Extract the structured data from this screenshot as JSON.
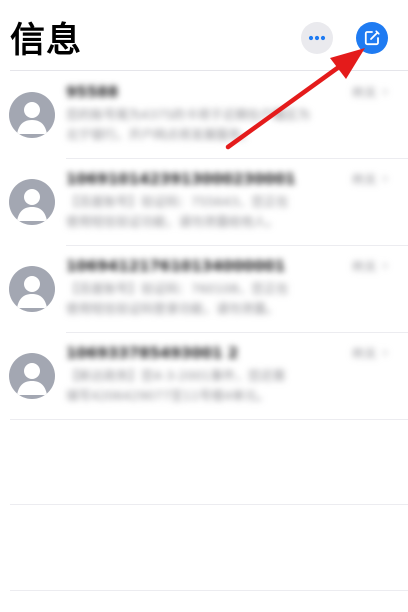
{
  "header": {
    "title": "信息"
  },
  "icons": {
    "more": "ellipsis-icon",
    "compose": "compose-icon",
    "avatar": "person-icon",
    "chevron": "chevron-right-icon"
  },
  "colors": {
    "accent": "#1f7bf2",
    "annotation": "#e41b1b",
    "avatar": "#a3a7b2"
  },
  "conversations": [
    {
      "sender": "95588",
      "time": "昨天",
      "preview_line1": "您的账号尾为4375的卡将于近期在户籍区为",
      "preview_line2": "北宁银行。开户网点将发展服务。"
    },
    {
      "sender": "1069101423913000230001",
      "time": "昨天",
      "preview_line1": "【百度账号】验证码：755643，您正在",
      "preview_line2": "使用短信验证功能，请勿泄露给他人。"
    },
    {
      "sender": "106941217610134000001",
      "time": "昨天",
      "preview_line1": "【百度账号】验证码：760108，您正在",
      "preview_line2": "使用短信验证码登录功能，请勿泄露。"
    },
    {
      "sender": "106933785493001 2",
      "time": "昨天",
      "preview_line1": "【新达政务】您4-3-2001事件，您还需",
      "preview_line2": "填写4206429077至11号楼4单元。"
    }
  ]
}
